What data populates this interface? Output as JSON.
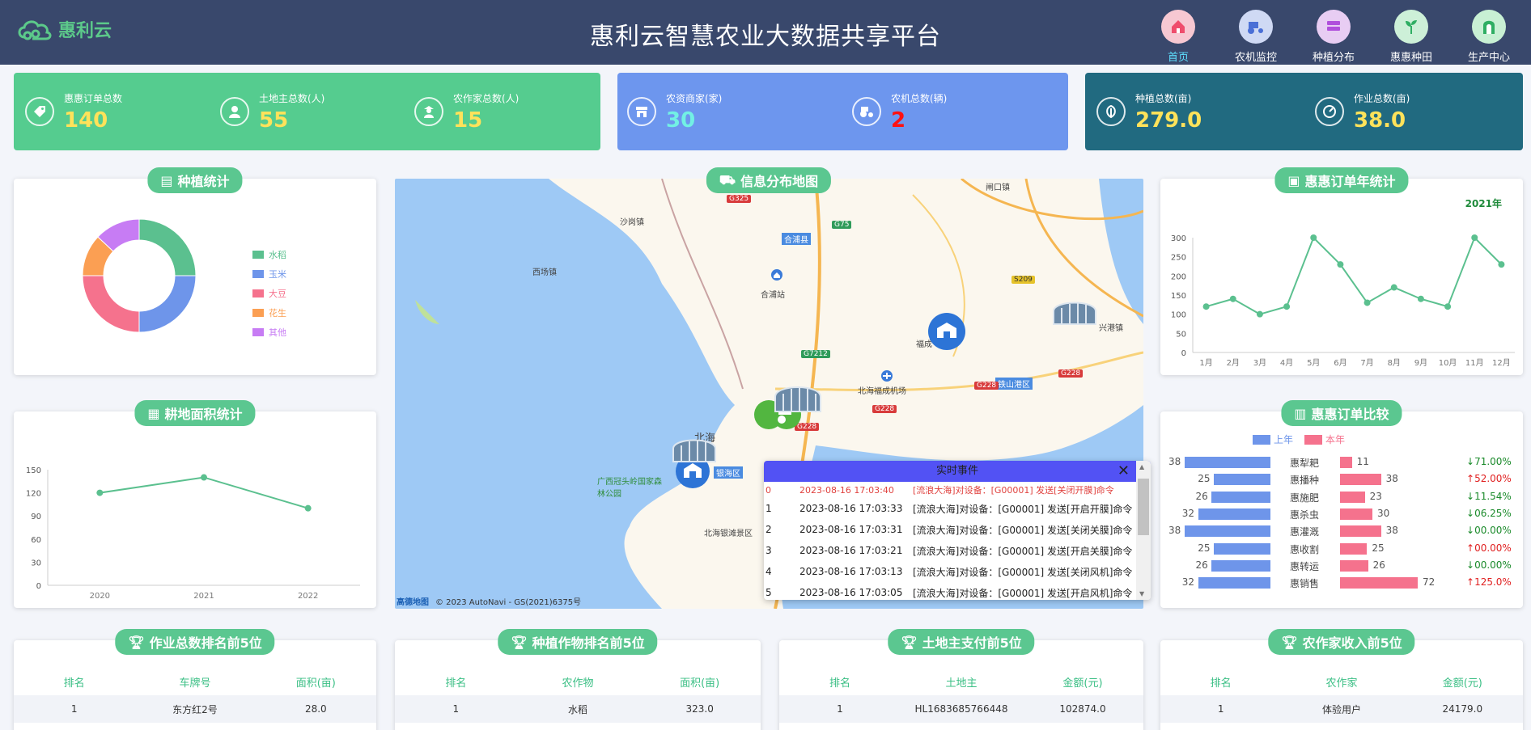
{
  "header": {
    "logo_text": "惠利云",
    "title": "惠利云智慧农业大数据共享平台",
    "nav": [
      {
        "label": "首页",
        "active": true,
        "color": "#f7c8d2"
      },
      {
        "label": "农机监控",
        "active": false,
        "color": "#cfd9f4"
      },
      {
        "label": "种植分布",
        "active": false,
        "color": "#e8cdf3"
      },
      {
        "label": "惠惠种田",
        "active": false,
        "color": "#cdf0d8"
      },
      {
        "label": "生产中心",
        "active": false,
        "color": "#c8f0d4"
      }
    ]
  },
  "stats": {
    "group1": [
      {
        "label": "惠惠订单总数",
        "value": "140"
      },
      {
        "label": "土地主总数(人)",
        "value": "55"
      },
      {
        "label": "农作家总数(人)",
        "value": "15"
      }
    ],
    "group2": [
      {
        "label": "农资商家(家)",
        "value": "30"
      },
      {
        "label": "农机总数(辆)",
        "value": "2"
      }
    ],
    "group3": [
      {
        "label": "种植总数(亩)",
        "value": "279.0"
      },
      {
        "label": "作业总数(亩)",
        "value": "38.0"
      }
    ]
  },
  "panels": {
    "planting": "种植统计",
    "map": "信息分布地图",
    "order_year": "惠惠订单年统计",
    "land_area": "耕地面积统计",
    "order_compare": "惠惠订单比较",
    "work_rank": "作业总数排名前5位",
    "crop_rank": "种植作物排名前5位",
    "land_pay": "土地主支付前5位",
    "farmer_income": "农作家收入前5位"
  },
  "donut": {
    "legend": [
      {
        "name": "水稻",
        "value": 25,
        "color": "#5bc08f"
      },
      {
        "name": "玉米",
        "value": 25,
        "color": "#6e95ea"
      },
      {
        "name": "大豆",
        "value": 25,
        "color": "#f5728d"
      },
      {
        "name": "花生",
        "value": 12,
        "color": "#fb9f53"
      },
      {
        "name": "其他",
        "value": 13,
        "color": "#c77cf4"
      }
    ]
  },
  "map": {
    "labels": [
      "沙岗镇",
      "西场镇",
      "合浦县",
      "合浦站",
      "福成",
      "北海福成机场",
      "铁山港区",
      "北海",
      "银海区",
      "广西冠头岭国家森林公园",
      "北海银滩景区",
      "闸口镇",
      "兴港镇"
    ],
    "roads": [
      "G325",
      "G75",
      "S209",
      "G7212",
      "G228",
      "G228",
      "G228",
      "G228"
    ],
    "credit": "© 2023 AutoNavi - GS(2021)6375号",
    "brand": "高德地图"
  },
  "events": {
    "title": "实时事件",
    "rows": [
      {
        "idx": "0",
        "time": "2023-08-16 17:03:40",
        "text": "[流浪大海]对设备：[G00001] 发送[关闭开膜]命令",
        "hl": true
      },
      {
        "idx": "1",
        "time": "2023-08-16 17:03:33",
        "text": "[流浪大海]对设备：[G00001] 发送[开启开膜]命令",
        "hl": false
      },
      {
        "idx": "2",
        "time": "2023-08-16 17:03:31",
        "text": "[流浪大海]对设备：[G00001] 发送[关闭关膜]命令",
        "hl": false
      },
      {
        "idx": "3",
        "time": "2023-08-16 17:03:21",
        "text": "[流浪大海]对设备：[G00001] 发送[开启关膜]命令",
        "hl": false
      },
      {
        "idx": "4",
        "time": "2023-08-16 17:03:13",
        "text": "[流浪大海]对设备：[G00001] 发送[关闭风机]命令",
        "hl": false
      },
      {
        "idx": "5",
        "time": "2023-08-16 17:03:05",
        "text": "[流浪大海]对设备：[G00001] 发送[开启风机]命令",
        "hl": false
      }
    ]
  },
  "chart_data": [
    {
      "type": "line",
      "title": "2021年",
      "categories": [
        "1月",
        "2月",
        "3月",
        "4月",
        "5月",
        "6月",
        "7月",
        "8月",
        "9月",
        "10月",
        "11月",
        "12月"
      ],
      "values": [
        120,
        140,
        100,
        120,
        300,
        230,
        130,
        170,
        140,
        120,
        300,
        230
      ],
      "yticks": [
        0,
        50,
        100,
        150,
        200,
        250,
        300
      ],
      "ylim": [
        0,
        300
      ],
      "color": "#5bc08f"
    },
    {
      "type": "line",
      "categories": [
        "2020",
        "2021",
        "2022"
      ],
      "values": [
        120,
        140,
        100
      ],
      "yticks": [
        0,
        30,
        60,
        90,
        120,
        150
      ],
      "ylim": [
        0,
        150
      ],
      "color": "#5bc08f"
    },
    {
      "type": "bar",
      "legend": [
        "上年",
        "本年"
      ],
      "colors": [
        "#6e95ea",
        "#f5728d"
      ],
      "categories": [
        "惠犁耙",
        "惠播种",
        "惠施肥",
        "惠杀虫",
        "惠灌溉",
        "惠收割",
        "惠转运",
        "惠销售"
      ],
      "series": [
        {
          "name": "上年",
          "values": [
            38,
            25,
            26,
            32,
            38,
            25,
            26,
            32
          ]
        },
        {
          "name": "本年",
          "values": [
            11,
            38,
            23,
            30,
            38,
            25,
            26,
            72
          ]
        }
      ],
      "changes": [
        {
          "text": "71.00%",
          "dir": "down"
        },
        {
          "text": "52.00%",
          "dir": "up"
        },
        {
          "text": "11.54%",
          "dir": "down"
        },
        {
          "text": "06.25%",
          "dir": "down"
        },
        {
          "text": "00.00%",
          "dir": "down"
        },
        {
          "text": "00.00%",
          "dir": "up"
        },
        {
          "text": "00.00%",
          "dir": "down"
        },
        {
          "text": "125.0%",
          "dir": "up"
        }
      ]
    }
  ],
  "tables": {
    "work_rank": {
      "headers": [
        "排名",
        "车牌号",
        "面积(亩)"
      ],
      "rows": [
        [
          "1",
          "东方红2号",
          "28.0"
        ]
      ]
    },
    "crop_rank": {
      "headers": [
        "排名",
        "农作物",
        "面积(亩)"
      ],
      "rows": [
        [
          "1",
          "水稻",
          "323.0"
        ]
      ]
    },
    "land_pay": {
      "headers": [
        "排名",
        "土地主",
        "金额(元)"
      ],
      "rows": [
        [
          "1",
          "HL1683685766448",
          "102874.0"
        ]
      ]
    },
    "farmer_income": {
      "headers": [
        "排名",
        "农作家",
        "金额(元)"
      ],
      "rows": [
        [
          "1",
          "体验用户",
          "24179.0"
        ]
      ]
    }
  }
}
